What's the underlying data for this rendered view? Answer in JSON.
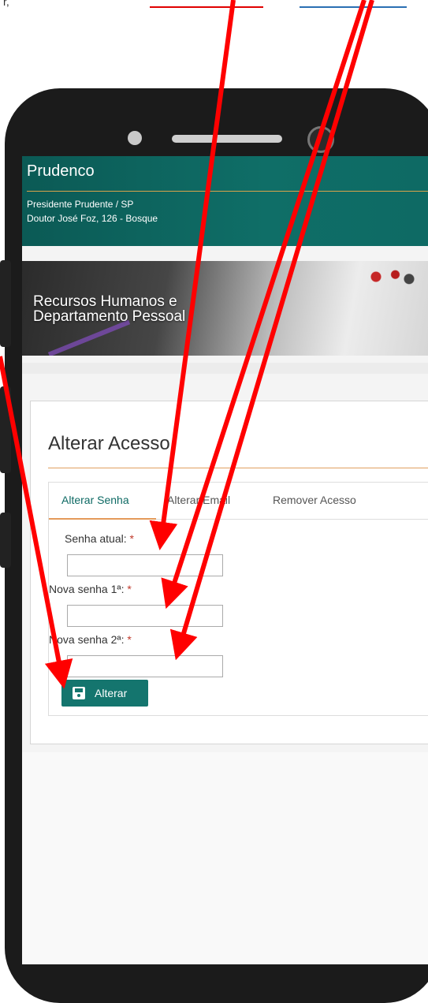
{
  "page": {
    "top_fragment": "r,"
  },
  "app": {
    "org_name": "Prudenco",
    "city": "Presidente Prudente / SP",
    "address": "Doutor José Foz, 126 - Bosque"
  },
  "banner": {
    "line1": "Recursos Humanos e",
    "line2": "Departamento Pessoal"
  },
  "card": {
    "title": "Alterar Acesso",
    "tabs": [
      {
        "label": "Alterar Senha",
        "active": true
      },
      {
        "label": "Alterar Email",
        "active": false
      },
      {
        "label": "Remover Acesso",
        "active": false
      }
    ],
    "form": {
      "current_password_label": "Senha atual:",
      "new_password1_label": "Nova senha 1ª:",
      "new_password2_label": "Nova senha 2ª:",
      "required_mark": "*",
      "current_password_value": "",
      "new_password1_value": "",
      "new_password2_value": "",
      "submit_label": "Alterar"
    }
  },
  "colors": {
    "header": "#0f6e67",
    "accent": "#e49a5a",
    "button": "#14756e",
    "arrow": "#ff0000"
  }
}
